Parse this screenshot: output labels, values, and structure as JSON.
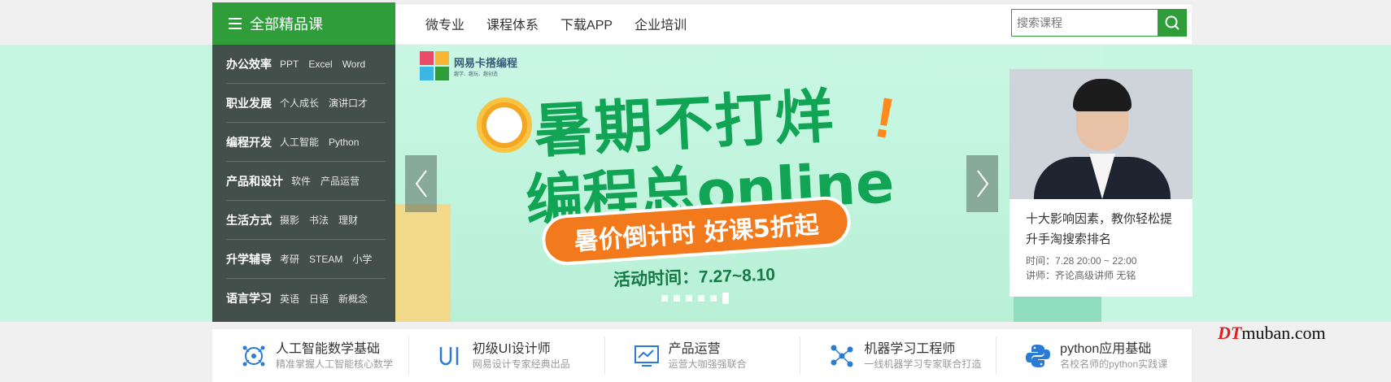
{
  "header": {
    "all_courses_label": "全部精品课",
    "nav": [
      "微专业",
      "课程体系",
      "下载APP",
      "企业培训"
    ],
    "search_placeholder": "搜索课程"
  },
  "sidebar": {
    "categories": [
      {
        "main": "办公效率",
        "subs": [
          "PPT",
          "Excel",
          "Word"
        ]
      },
      {
        "main": "职业发展",
        "subs": [
          "个人成长",
          "演讲口才"
        ]
      },
      {
        "main": "编程开发",
        "subs": [
          "人工智能",
          "Python"
        ]
      },
      {
        "main": "产品和设计",
        "subs": [
          "软件",
          "产品运营"
        ]
      },
      {
        "main": "生活方式",
        "subs": [
          "摄影",
          "书法",
          "理财"
        ]
      },
      {
        "main": "升学辅导",
        "subs": [
          "考研",
          "STEAM",
          "小学"
        ]
      },
      {
        "main": "语言学习",
        "subs": [
          "英语",
          "日语",
          "新概念"
        ]
      }
    ]
  },
  "banner": {
    "logo_title": "网易卡搭编程",
    "logo_sub": "趣学、趣玩、趣创造",
    "slogan_line1": "暑期不打烊",
    "slogan_line2": "编程总online",
    "exclamation": "!",
    "pill_text": "暑价倒计时 好课5折起",
    "activity_time": "活动时间：7.27~8.10",
    "slide_count": 6,
    "active_slide": 6
  },
  "live": {
    "title": "十大影响因素，教你轻松提升手淘搜索排名",
    "time": "时间：7.28 20:00 ~ 22:00",
    "lecturer": "讲师：齐论高级讲师 无铭"
  },
  "courses": [
    {
      "title": "人工智能数学基础",
      "desc": "精准掌握人工智能核心数学",
      "icon": "ai-brain-icon"
    },
    {
      "title": "初级UI设计师",
      "desc": "网易设计专家经典出品",
      "icon": "ui-icon"
    },
    {
      "title": "产品运营",
      "desc": "运营大咖强强联合",
      "icon": "monitor-chart-icon"
    },
    {
      "title": "机器学习工程师",
      "desc": "一线机器学习专家联合打造",
      "icon": "network-icon"
    },
    {
      "title": "python应用基础",
      "desc": "名校名师的python实践课",
      "icon": "python-icon"
    }
  ],
  "watermark": {
    "dt": "DT",
    "rest": "muban.com"
  },
  "colors": {
    "brand_green": "#2e9d3a",
    "banner_green": "#c6f6e1",
    "accent_blue": "#2a7bd5"
  }
}
